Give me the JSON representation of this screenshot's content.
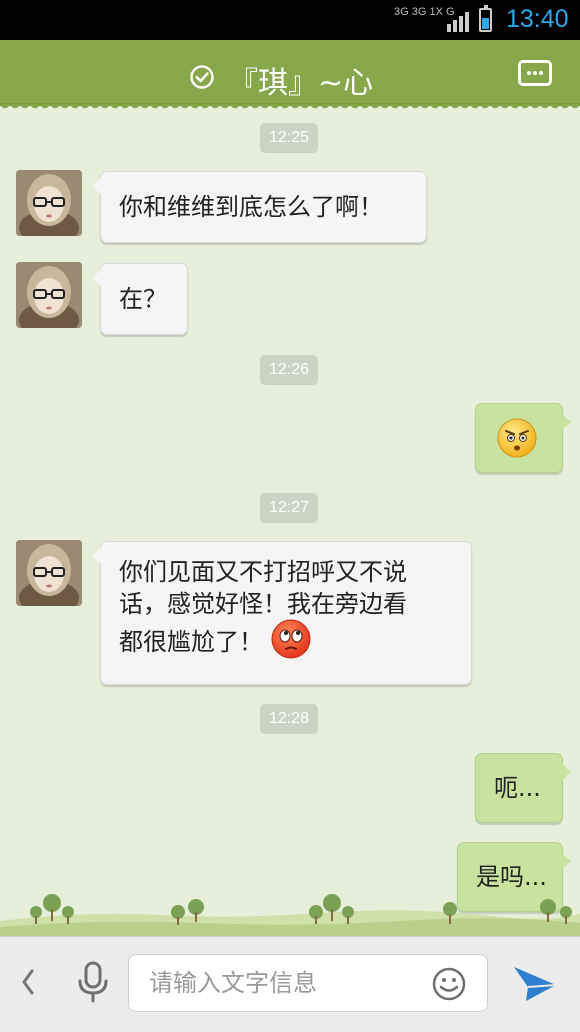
{
  "status_bar": {
    "network": "3G 3G 1X G",
    "time": "13:40"
  },
  "header": {
    "title": "『琪』~心"
  },
  "messages": [
    {
      "type": "timestamp",
      "text": "12:25"
    },
    {
      "type": "incoming",
      "text": "你和维维到底怎么了啊！"
    },
    {
      "type": "incoming",
      "text": "在？"
    },
    {
      "type": "timestamp",
      "text": "12:26"
    },
    {
      "type": "outgoing",
      "emoji": "annoyed-face-emoji"
    },
    {
      "type": "timestamp",
      "text": "12:27"
    },
    {
      "type": "incoming",
      "lines": [
        "你们见面又不打招呼又不说",
        "话，感觉好怪！我在旁边看",
        "都很尴尬了！"
      ],
      "emoji": "rolling-eyes-face-emoji"
    },
    {
      "type": "timestamp",
      "text": "12:28"
    },
    {
      "type": "outgoing",
      "text": "呃..."
    },
    {
      "type": "outgoing",
      "text": "是吗..."
    }
  ],
  "input": {
    "placeholder": "请输入文字信息"
  },
  "colors": {
    "header": "#86a84b",
    "background": "#e7efda",
    "outgoing_bubble": "#c8e39f",
    "incoming_bubble": "#f5f5f5",
    "send_icon": "#2e7fcf"
  }
}
